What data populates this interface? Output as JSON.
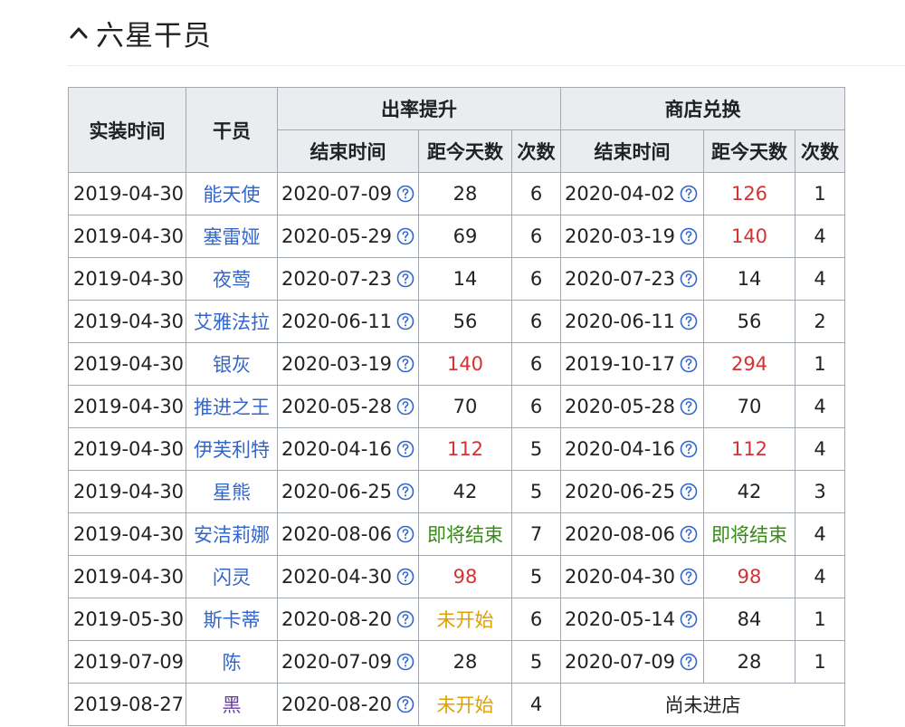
{
  "section": {
    "title": "六星干员",
    "chevron_icon": "chevron-up-icon"
  },
  "table": {
    "headers": {
      "release": "实装时间",
      "operator": "干员",
      "rate_up_group": "出率提升",
      "shop_group": "商店兑换",
      "end_time": "结束时间",
      "days": "距今天数",
      "count": "次数"
    },
    "help_icon": "question-circle-icon",
    "colors": {
      "link": "#3366cc",
      "red": "#d33333",
      "green": "#3a8a1a",
      "orange": "#e0a000",
      "purple": "#6b3fa0",
      "header_bg": "#eaecf0",
      "border": "#a2a9b1"
    },
    "rows": [
      {
        "release": "2019-04-30",
        "operator": "能天使",
        "rate_end": "2020-07-09",
        "rate_days": "28",
        "rate_days_style": "plain",
        "rate_count": "6",
        "shop_end": "2020-04-02",
        "shop_days": "126",
        "shop_days_style": "red",
        "shop_count": "1"
      },
      {
        "release": "2019-04-30",
        "operator": "塞雷娅",
        "rate_end": "2020-05-29",
        "rate_days": "69",
        "rate_days_style": "plain",
        "rate_count": "6",
        "shop_end": "2020-03-19",
        "shop_days": "140",
        "shop_days_style": "red",
        "shop_count": "4"
      },
      {
        "release": "2019-04-30",
        "operator": "夜莺",
        "rate_end": "2020-07-23",
        "rate_days": "14",
        "rate_days_style": "plain",
        "rate_count": "6",
        "shop_end": "2020-07-23",
        "shop_days": "14",
        "shop_days_style": "plain",
        "shop_count": "4"
      },
      {
        "release": "2019-04-30",
        "operator": "艾雅法拉",
        "rate_end": "2020-06-11",
        "rate_days": "56",
        "rate_days_style": "plain",
        "rate_count": "6",
        "shop_end": "2020-06-11",
        "shop_days": "56",
        "shop_days_style": "plain",
        "shop_count": "2"
      },
      {
        "release": "2019-04-30",
        "operator": "银灰",
        "rate_end": "2020-03-19",
        "rate_days": "140",
        "rate_days_style": "red",
        "rate_count": "6",
        "shop_end": "2019-10-17",
        "shop_days": "294",
        "shop_days_style": "red",
        "shop_count": "1"
      },
      {
        "release": "2019-04-30",
        "operator": "推进之王",
        "rate_end": "2020-05-28",
        "rate_days": "70",
        "rate_days_style": "plain",
        "rate_count": "6",
        "shop_end": "2020-05-28",
        "shop_days": "70",
        "shop_days_style": "plain",
        "shop_count": "4"
      },
      {
        "release": "2019-04-30",
        "operator": "伊芙利特",
        "rate_end": "2020-04-16",
        "rate_days": "112",
        "rate_days_style": "red",
        "rate_count": "5",
        "shop_end": "2020-04-16",
        "shop_days": "112",
        "shop_days_style": "red",
        "shop_count": "4"
      },
      {
        "release": "2019-04-30",
        "operator": "星熊",
        "rate_end": "2020-06-25",
        "rate_days": "42",
        "rate_days_style": "plain",
        "rate_count": "5",
        "shop_end": "2020-06-25",
        "shop_days": "42",
        "shop_days_style": "plain",
        "shop_count": "3"
      },
      {
        "release": "2019-04-30",
        "operator": "安洁莉娜",
        "rate_end": "2020-08-06",
        "rate_days": "即将结束",
        "rate_days_style": "green",
        "rate_count": "7",
        "shop_end": "2020-08-06",
        "shop_days": "即将结束",
        "shop_days_style": "green",
        "shop_count": "4"
      },
      {
        "release": "2019-04-30",
        "operator": "闪灵",
        "rate_end": "2020-04-30",
        "rate_days": "98",
        "rate_days_style": "red",
        "rate_count": "5",
        "shop_end": "2020-04-30",
        "shop_days": "98",
        "shop_days_style": "red",
        "shop_count": "4"
      },
      {
        "release": "2019-05-30",
        "operator": "斯卡蒂",
        "rate_end": "2020-08-20",
        "rate_days": "未开始",
        "rate_days_style": "orange",
        "rate_count": "6",
        "shop_end": "2020-05-14",
        "shop_days": "84",
        "shop_days_style": "plain",
        "shop_count": "1"
      },
      {
        "release": "2019-07-09",
        "operator": "陈",
        "rate_end": "2020-07-09",
        "rate_days": "28",
        "rate_days_style": "plain",
        "rate_count": "5",
        "shop_end": "2020-07-09",
        "shop_days": "28",
        "shop_days_style": "plain",
        "shop_count": "1"
      },
      {
        "release": "2019-08-27",
        "operator": "黑",
        "operator_style": "purple",
        "rate_end": "2020-08-20",
        "rate_days": "未开始",
        "rate_days_style": "orange",
        "rate_count": "4",
        "shop_note": "尚未进店"
      }
    ]
  }
}
